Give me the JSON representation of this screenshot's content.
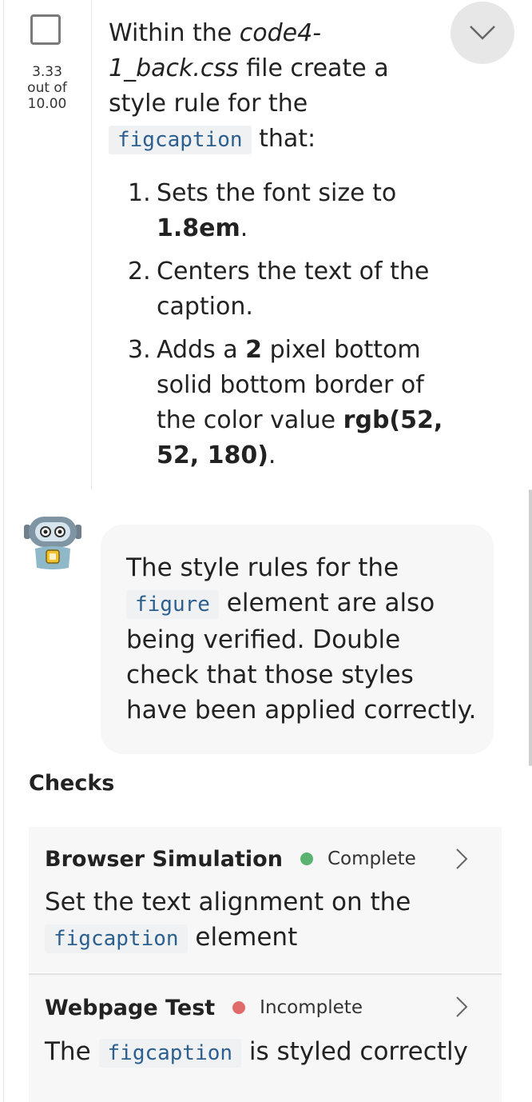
{
  "task": {
    "score_value": "3.33",
    "score_out_of": "out of",
    "score_total": "10.00",
    "intro_1": "Within the ",
    "file_name": "code4-1_back.css",
    "intro_2": " file create a style rule for the ",
    "selector": "figcaption",
    "intro_3": " that:",
    "steps": [
      {
        "num": "1.",
        "pre": "Sets the font size to ",
        "bold": "1.8em",
        "post": "."
      },
      {
        "num": "2.",
        "pre": "Centers the text of the caption."
      },
      {
        "num": "3.",
        "pre": "Adds a ",
        "bold": "2",
        "mid": " pixel bottom solid bottom border of the color value ",
        "bold2": "rgb(52, 52, 180)",
        "post": "."
      }
    ]
  },
  "assistant": {
    "icon": "robot-icon",
    "text_1": "The style rules for the ",
    "code": "figure",
    "text_2": " element are also being verified. Double check that those styles have been applied correctly."
  },
  "checks": {
    "title": "Checks",
    "items": [
      {
        "name": "Browser Simulation",
        "status": "Complete",
        "status_color": "#5cb270",
        "desc_1": "Set the text alignment on the ",
        "code": "figcaption",
        "desc_2": " element"
      },
      {
        "name": "Webpage Test",
        "status": "Incomplete",
        "status_color": "#e06b6b",
        "desc_1": "The ",
        "code": "figcaption",
        "desc_2": " is styled correctly"
      }
    ]
  },
  "colors": {
    "code_text": "#2b5f8f",
    "code_bg": "#f0f1f3",
    "bubble_bg": "#f7f7f7",
    "collapse_bg": "#e7e7e7"
  }
}
